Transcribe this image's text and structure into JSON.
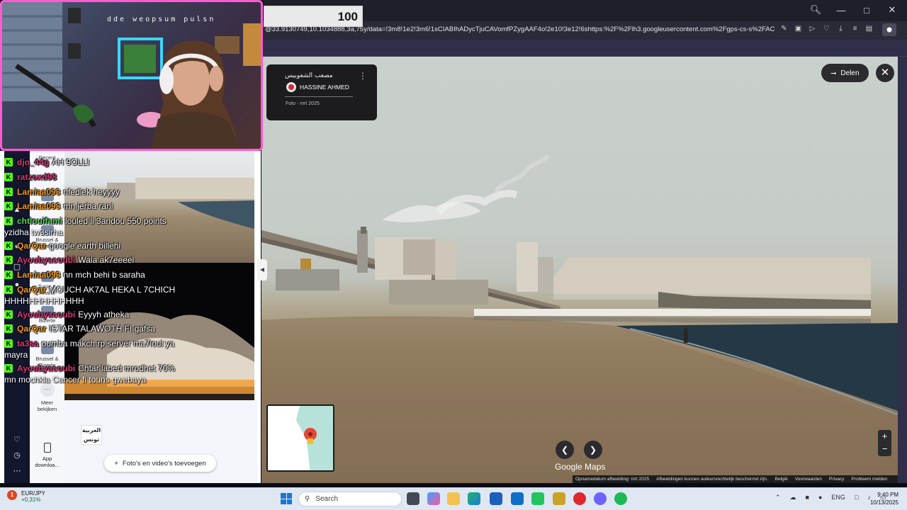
{
  "score_box": "100",
  "browser": {
    "url": "@33.9130749,10.1034888,3a,75y/data=!3m8!1e2!3m6!1sCIABIhADycTjuCAVomfPZygAAF4o!2e10!3e12!6shttps:%2F%2Flh3.googleusercontent.com%2Fgps-cs-s%2FAC9h4npq0NoU1HIVVU"
  },
  "webcam": {
    "overlay_text": "dde weopsum pulsn"
  },
  "streetview": {
    "contributor_arabic": "مصعب الشعوبيس",
    "contributor_name": "HASSINE AHMED",
    "photo_date": "Foto - mrt 2025",
    "share_label": "Delen",
    "brand": "Google Maps",
    "footer": [
      "Opnamedatum afbeelding: mrt 2025",
      "Afbeeldingen kunnen auteursrechtelijk beschermd zijn.",
      "België",
      "Voorwaarden",
      "Privacy",
      "Probleem melden"
    ],
    "zoom_in": "+",
    "zoom_out": "−"
  },
  "left_panel": {
    "recents": [
      "Recent",
      "Gabes",
      "Brussel & Tongere...",
      "Tunis & Ariana",
      "Bizerte",
      "Brussel & Bizerte"
    ],
    "more": "Meer bekijken",
    "app_download": "App downloa...",
    "add_media": "Foto's en video's toevoegen",
    "channel_logo": "العربية تونس"
  },
  "chat": [
    {
      "user": "djo_44g",
      "color": "#d93a7b",
      "msg": "AH 9OLLI"
    },
    {
      "user": "ratzoxd98",
      "color": "#d93a7b",
      "msg": ""
    },
    {
      "user": "Lamiaa093",
      "color": "#f39a1c",
      "msg": "nfedlek heyyyy"
    },
    {
      "user": "Lamiaa093",
      "color": "#f39a1c",
      "msg": "mn jerba rani"
    },
    {
      "user": "chtiouifami",
      "color": "#5cd65c",
      "msg": "louled li 3andou 550 points"
    },
    {
      "user": "QarQar",
      "color": "#f39a1c",
      "msg": "google earth billehi"
    },
    {
      "user": "Ayoubyacoubi",
      "color": "#d93a7b",
      "msg": "Wala ak7eeeel"
    },
    {
      "user": "Lamiaa093",
      "color": "#f39a1c",
      "msg": "nn mch behi b saraha"
    },
    {
      "user": "QarQar",
      "color": "#f39a1c",
      "msg": "MOUCH AK7AL HEKA L 7CHICH"
    },
    {
      "user": "Ayoubyacoubi",
      "color": "#d93a7b",
      "msg": "Eyyyh atheka"
    },
    {
      "user": "QarQar",
      "color": "#f39a1c",
      "msg": "ISTAR TALAWOTH FI gafsa"
    },
    {
      "user": "ta3sa",
      "color": "#d93a7b",
      "msg": "oumba makch rp server ma7loul ya"
    },
    {
      "user": "Ayoubyacoubi",
      "color": "#d93a7b",
      "msg": "Chtar labed mrodhet 70%"
    }
  ],
  "chat_continuations": [
    "yzidha tw3sirha",
    "HHHHHHHHHHHHH",
    "mayra",
    "mn mochkla Cancer fi touns gwebaya"
  ],
  "taskbar": {
    "ticker_badge": "1",
    "ticker_name": "EUR/JPY",
    "ticker_change": "+0,31%",
    "search_label": "Search",
    "language": "ENG",
    "time": "9:40 PM",
    "date": "10/13/2025"
  }
}
